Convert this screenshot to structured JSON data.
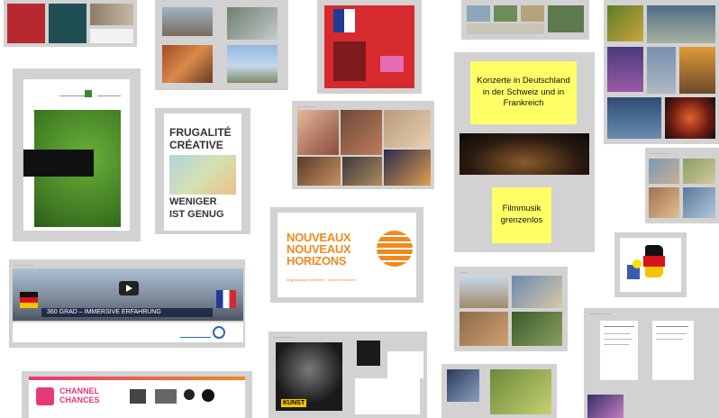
{
  "cards": {
    "konzerte_label": "Konzerte in Deutschland in der Schweiz und in Frankreich",
    "filmmusik_label": "Filmmusik grenzenlos",
    "frugalite": {
      "line1": "FRUGALITÉ",
      "line2": "CRÉATIVE",
      "line3": "WENIGER",
      "line4": "IST GENUG"
    },
    "nouveaux": {
      "line1": "NOUVEAUX",
      "line2": "NOUVEAUX",
      "line3": "HORIZONS",
      "tagline": "Begegnungen erweitern · Europe erkunden"
    },
    "channel": {
      "line1": "CHANNEL",
      "line2": "CHANCES"
    },
    "video_caption": "360 GRAD – IMMERSIVE ERFAHRUNG",
    "kunst_label": "KUNST"
  },
  "colors": {
    "card_bg": "#d3d2d2",
    "yellow": "#ffff66",
    "orange": "#f08a1e",
    "green": "#4a8a22",
    "dark": "#1a1a1a"
  }
}
